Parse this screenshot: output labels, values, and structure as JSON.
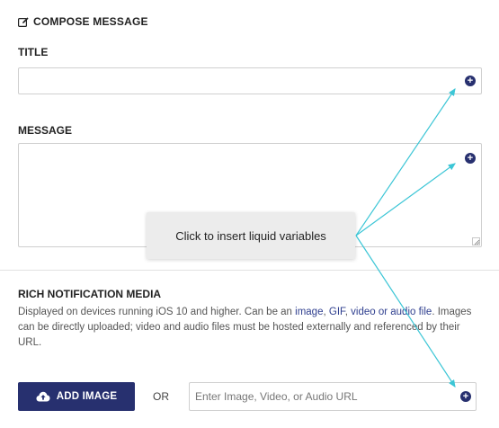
{
  "compose": {
    "heading": "COMPOSE MESSAGE",
    "title_label": "TITLE",
    "title_value": "",
    "message_label": "MESSAGE",
    "message_value": ""
  },
  "rich_media": {
    "heading": "RICH NOTIFICATION MEDIA",
    "description_pre": "Displayed on devices running iOS 10 and higher. Can be an ",
    "link_image": "image",
    "sep1": ", ",
    "link_gif": "GIF",
    "sep2": ", ",
    "link_video_audio": "video or audio file",
    "description_post": ". Images can be directly uploaded; video and audio files must be hosted externally and referenced by their URL.",
    "add_image_label": "ADD IMAGE",
    "or_label": "OR",
    "url_placeholder": "Enter Image, Video, or Audio URL",
    "url_value": ""
  },
  "tooltip": {
    "text": "Click to insert liquid variables"
  },
  "icons": {
    "heading_icon": "edit-icon",
    "insert_icon": "plus-circle-icon",
    "upload_icon": "cloud-upload-icon"
  },
  "colors": {
    "accent": "#27306f",
    "link": "#2f3f8f",
    "arrow": "#3cc6d6",
    "tooltip_bg": "#ececec"
  }
}
